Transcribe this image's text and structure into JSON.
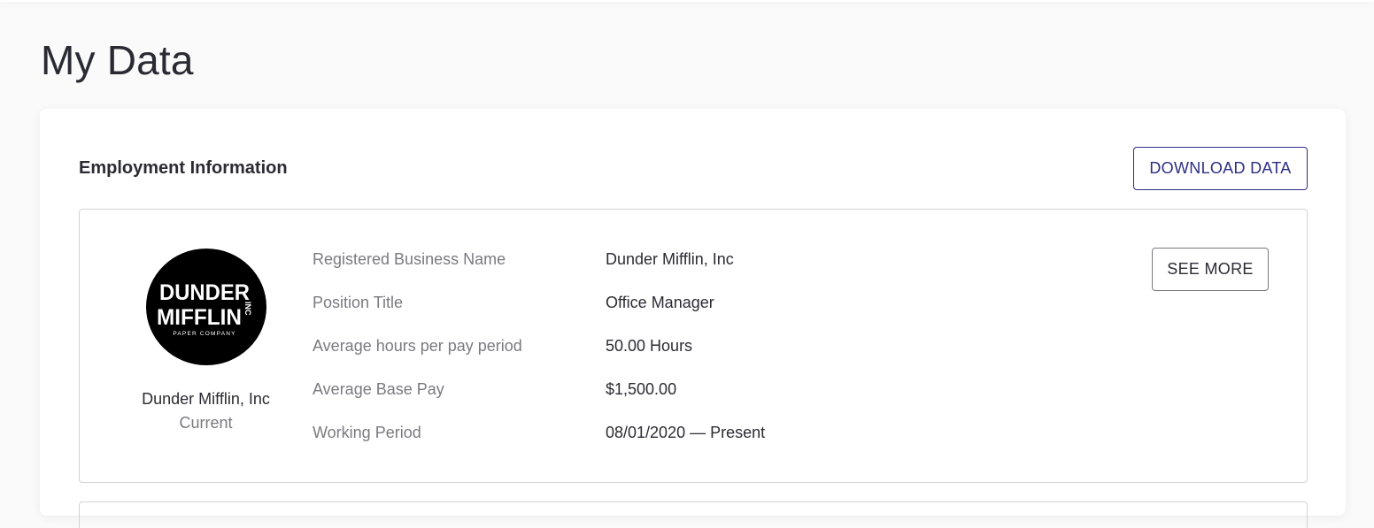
{
  "page": {
    "title": "My Data"
  },
  "employment_section": {
    "title": "Employment Information",
    "download_label": "DOWNLOAD DATA"
  },
  "employer": {
    "logo": {
      "icon": "dunder-mifflin-logo",
      "line1": "DUNDER",
      "line2": "MIFFLIN",
      "suffix": "INC",
      "tagline": "PAPER COMPANY",
      "background_color": "#000000",
      "text_color": "#ffffff"
    },
    "name": "Dunder Mifflin, Inc",
    "status": "Current",
    "see_more_label": "SEE MORE",
    "details": [
      {
        "label": "Registered Business Name",
        "value": "Dunder Mifflin, Inc"
      },
      {
        "label": "Position Title",
        "value": "Office Manager"
      },
      {
        "label": "Average hours per pay period",
        "value": "50.00 Hours"
      },
      {
        "label": "Average Base Pay",
        "value": "$1,500.00"
      },
      {
        "label": "Working Period",
        "value": "08/01/2020 — Present"
      }
    ]
  },
  "colors": {
    "accent": "#2d2e83",
    "muted_text": "#7a7a80",
    "border": "#d3d3d8"
  }
}
